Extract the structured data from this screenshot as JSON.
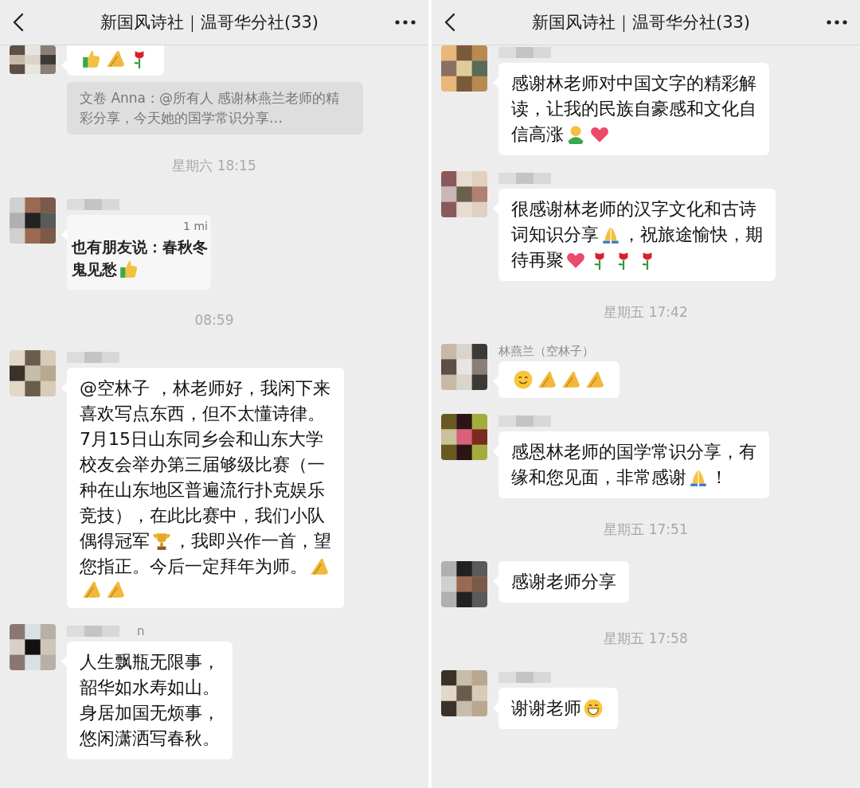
{
  "panels": [
    {
      "header": {
        "title": "新国风诗社｜温哥华分社(33)"
      },
      "feed": [
        {
          "kind": "message",
          "sender_blurred": false,
          "cut_top": true,
          "bubble": {
            "kind": "text",
            "lines": [
              [
                {
                  "kind": "thumbs-up"
                },
                {
                  "kind": "palms"
                },
                {
                  "kind": "rose"
                }
              ]
            ]
          }
        },
        {
          "kind": "quote",
          "text": "文卷 Anna：@所有人 感谢林燕兰老师的精彩分享，今天她的国学常识分享…"
        },
        {
          "kind": "time",
          "text": "星期六 18:15"
        },
        {
          "kind": "message",
          "sender_blurred": true,
          "bubble": {
            "caption": "1 mi",
            "lines": [
              [
                {
                  "kind": "text",
                  "text": "也有朋友说：春秋冬"
                }
              ],
              [
                {
                  "kind": "text",
                  "text": "鬼见愁"
                },
                {
                  "kind": "thumbs-up"
                }
              ]
            ]
          }
        },
        {
          "kind": "time",
          "text": "08:59"
        },
        {
          "kind": "message",
          "sender_blurred": true,
          "bubble": {
            "kind": "text",
            "lines": [
              [
                {
                  "kind": "text",
                  "text": "@空林子 ，林老师好，我闲下来"
                }
              ],
              [
                {
                  "kind": "text",
                  "text": "喜欢写点东西，但不太懂诗律。"
                }
              ],
              [
                {
                  "kind": "text",
                  "text": "7月15日山东同乡会和山东大学"
                }
              ],
              [
                {
                  "kind": "text",
                  "text": "校友会举办第三届够级比赛（一"
                }
              ],
              [
                {
                  "kind": "text",
                  "text": "种在山东地区普遍流行扑克娱乐"
                }
              ],
              [
                {
                  "kind": "text",
                  "text": "竞技），在此比赛中，我们小队"
                }
              ],
              [
                {
                  "kind": "text",
                  "text": "偶得冠军"
                },
                {
                  "kind": "trophy"
                },
                {
                  "kind": "text",
                  "text": "，我即兴作一首，望"
                }
              ],
              [
                {
                  "kind": "text",
                  "text": "您指正。今后一定拜年为师。"
                },
                {
                  "kind": "palms"
                }
              ],
              [
                {
                  "kind": "palms"
                },
                {
                  "kind": "palms"
                }
              ]
            ]
          }
        },
        {
          "kind": "message",
          "sender_blurred": true,
          "sender": "n",
          "bubble": {
            "kind": "text",
            "lines": [
              [
                {
                  "kind": "text",
                  "text": "人生飘瓶无限事，"
                }
              ],
              [
                {
                  "kind": "text",
                  "text": "韶华如水寿如山。"
                }
              ],
              [
                {
                  "kind": "text",
                  "text": "身居加国无烦事，"
                }
              ],
              [
                {
                  "kind": "text",
                  "text": "悠闲潇洒写春秋。"
                }
              ]
            ]
          }
        }
      ]
    },
    {
      "header": {
        "title": "新国风诗社｜温哥华分社(33)"
      },
      "feed": [
        {
          "kind": "message",
          "sender_blurred": true,
          "bubble": {
            "kind": "text",
            "lines": [
              [
                {
                  "kind": "text",
                  "text": "感谢林老师对中国文字的精彩解"
                }
              ],
              [
                {
                  "kind": "text",
                  "text": "读，让我的民族自豪感和文化自"
                }
              ],
              [
                {
                  "kind": "text",
                  "text": "信高涨"
                },
                {
                  "kind": "figure"
                },
                {
                  "kind": "heart"
                }
              ]
            ]
          }
        },
        {
          "kind": "message",
          "sender_blurred": true,
          "bubble": {
            "kind": "text",
            "lines": [
              [
                {
                  "kind": "text",
                  "text": "很感谢林老师的汉字文化和古诗"
                }
              ],
              [
                {
                  "kind": "text",
                  "text": "词知识分享"
                },
                {
                  "kind": "pray"
                },
                {
                  "kind": "text",
                  "text": "，祝旅途愉快，期"
                }
              ],
              [
                {
                  "kind": "text",
                  "text": "待再聚"
                },
                {
                  "kind": "heart"
                },
                {
                  "kind": "rose"
                },
                {
                  "kind": "rose"
                },
                {
                  "kind": "rose"
                }
              ]
            ]
          }
        },
        {
          "kind": "time",
          "text": "星期五 17:42"
        },
        {
          "kind": "message",
          "sender_blurred": false,
          "sender": "林燕兰（空林子）",
          "bubble": {
            "kind": "text",
            "lines": [
              [
                {
                  "kind": "smile"
                },
                {
                  "kind": "palms"
                },
                {
                  "kind": "palms"
                },
                {
                  "kind": "palms"
                }
              ]
            ]
          }
        },
        {
          "kind": "message",
          "sender_blurred": true,
          "bubble": {
            "kind": "text",
            "lines": [
              [
                {
                  "kind": "text",
                  "text": "感恩林老师的国学常识分享，有"
                }
              ],
              [
                {
                  "kind": "text",
                  "text": "缘和您见面，非常感谢"
                },
                {
                  "kind": "pray"
                },
                {
                  "kind": "text",
                  "text": "！"
                }
              ]
            ]
          }
        },
        {
          "kind": "time",
          "text": "星期五 17:51"
        },
        {
          "kind": "message",
          "sender_blurred": false,
          "bubble": {
            "kind": "text",
            "lines": [
              [
                {
                  "kind": "text",
                  "text": "感谢老师分享"
                }
              ]
            ]
          }
        },
        {
          "kind": "time",
          "text": "星期五 17:58"
        },
        {
          "kind": "message",
          "sender_blurred": true,
          "bubble": {
            "kind": "text",
            "lines": [
              [
                {
                  "kind": "text",
                  "text": "谢谢老师"
                },
                {
                  "kind": "grin"
                }
              ]
            ]
          }
        }
      ]
    }
  ]
}
